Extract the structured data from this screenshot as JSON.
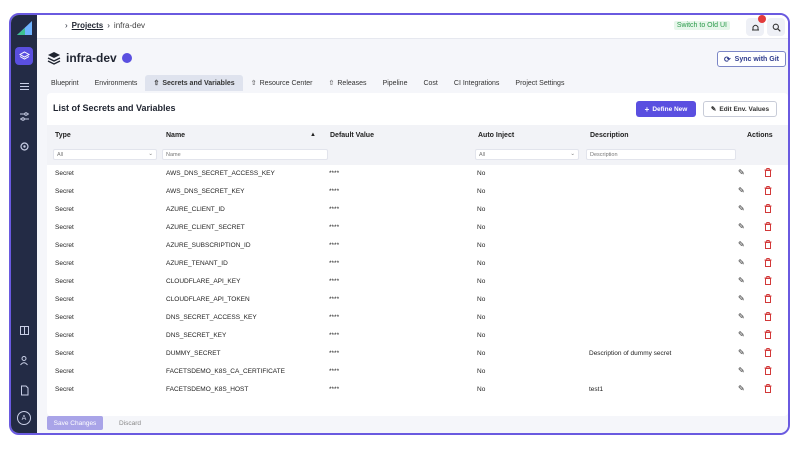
{
  "topbar": {
    "breadcrumb_projects": "Projects",
    "breadcrumb_current": "infra-dev",
    "switch_old_ui": "Switch to Old UI"
  },
  "header": {
    "title": "infra-dev",
    "sync_label": "Sync with Git"
  },
  "tabs": [
    {
      "label": "Blueprint",
      "active": false
    },
    {
      "label": "Environments",
      "active": false
    },
    {
      "label": "Secrets and Variables",
      "active": true
    },
    {
      "label": "Resource Center",
      "active": false
    },
    {
      "label": "Releases",
      "active": false
    },
    {
      "label": "Pipeline",
      "active": false
    },
    {
      "label": "Cost",
      "active": false
    },
    {
      "label": "CI Integrations",
      "active": false
    },
    {
      "label": "Project Settings",
      "active": false
    }
  ],
  "panel": {
    "title": "List of Secrets and Variables",
    "define_new": "Define New",
    "edit_env": "Edit Env. Values"
  },
  "table": {
    "headers": {
      "type": "Type",
      "name": "Name",
      "default_value": "Default Value",
      "auto_inject": "Auto Inject",
      "description": "Description",
      "actions": "Actions"
    },
    "filters": {
      "type_value": "All",
      "name_placeholder": "Name",
      "auto_inject_value": "All",
      "description_placeholder": "Description"
    },
    "rows": [
      {
        "type": "Secret",
        "name": "AWS_DNS_SECRET_ACCESS_KEY",
        "default": "****",
        "auto": "No",
        "desc": ""
      },
      {
        "type": "Secret",
        "name": "AWS_DNS_SECRET_KEY",
        "default": "****",
        "auto": "No",
        "desc": ""
      },
      {
        "type": "Secret",
        "name": "AZURE_CLIENT_ID",
        "default": "****",
        "auto": "No",
        "desc": ""
      },
      {
        "type": "Secret",
        "name": "AZURE_CLIENT_SECRET",
        "default": "****",
        "auto": "No",
        "desc": ""
      },
      {
        "type": "Secret",
        "name": "AZURE_SUBSCRIPTION_ID",
        "default": "****",
        "auto": "No",
        "desc": ""
      },
      {
        "type": "Secret",
        "name": "AZURE_TENANT_ID",
        "default": "****",
        "auto": "No",
        "desc": ""
      },
      {
        "type": "Secret",
        "name": "CLOUDFLARE_API_KEY",
        "default": "****",
        "auto": "No",
        "desc": ""
      },
      {
        "type": "Secret",
        "name": "CLOUDFLARE_API_TOKEN",
        "default": "****",
        "auto": "No",
        "desc": ""
      },
      {
        "type": "Secret",
        "name": "DNS_SECRET_ACCESS_KEY",
        "default": "****",
        "auto": "No",
        "desc": ""
      },
      {
        "type": "Secret",
        "name": "DNS_SECRET_KEY",
        "default": "****",
        "auto": "No",
        "desc": ""
      },
      {
        "type": "Secret",
        "name": "DUMMY_SECRET",
        "default": "****",
        "auto": "No",
        "desc": "Description of dummy secret"
      },
      {
        "type": "Secret",
        "name": "FACETSDEMO_K8S_CA_CERTIFICATE",
        "default": "****",
        "auto": "No",
        "desc": ""
      },
      {
        "type": "Secret",
        "name": "FACETSDEMO_K8S_HOST",
        "default": "****",
        "auto": "No",
        "desc": "test1"
      }
    ]
  },
  "footer": {
    "save": "Save Changes",
    "discard": "Discard"
  },
  "sidebar": {
    "avatar_initial": "A"
  },
  "colors": {
    "accent": "#5a4fe0",
    "sidebar_bg": "#232b45",
    "delete_red": "#d23838"
  }
}
